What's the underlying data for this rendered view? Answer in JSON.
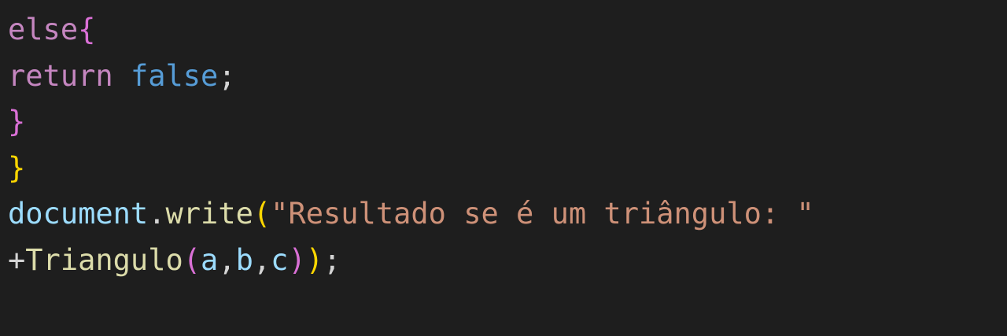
{
  "editor": {
    "background": "#1e1e1e",
    "lines": [
      [
        {
          "text": "else",
          "kind": "keyword"
        },
        {
          "text": "{",
          "kind": "bracket-pink"
        }
      ],
      [
        {
          "text": "return",
          "kind": "keyword"
        },
        {
          "text": " ",
          "kind": "plain"
        },
        {
          "text": "false",
          "kind": "bool"
        },
        {
          "text": ";",
          "kind": "plain"
        }
      ],
      [
        {
          "text": "}",
          "kind": "bracket-pink"
        }
      ],
      [
        {
          "text": "}",
          "kind": "bracket-gold"
        }
      ],
      [
        {
          "text": "document",
          "kind": "ident"
        },
        {
          "text": ".",
          "kind": "plain"
        },
        {
          "text": "write",
          "kind": "func"
        },
        {
          "text": "(",
          "kind": "bracket-gold"
        },
        {
          "text": "\"Resultado se é um triângulo: \"",
          "kind": "string"
        }
      ],
      [
        {
          "text": "+",
          "kind": "plain"
        },
        {
          "text": "Triangulo",
          "kind": "func"
        },
        {
          "text": "(",
          "kind": "bracket-pink"
        },
        {
          "text": "a",
          "kind": "ident"
        },
        {
          "text": ",",
          "kind": "plain"
        },
        {
          "text": "b",
          "kind": "ident"
        },
        {
          "text": ",",
          "kind": "plain"
        },
        {
          "text": "c",
          "kind": "ident"
        },
        {
          "text": ")",
          "kind": "bracket-pink"
        },
        {
          "text": ")",
          "kind": "bracket-gold"
        },
        {
          "text": ";",
          "kind": "plain"
        }
      ]
    ],
    "token_colors": {
      "keyword": "#c586c0",
      "bool": "#569cd6",
      "plain": "#d4d4d4",
      "ident": "#9cdcfe",
      "func": "#dcdcaa",
      "string": "#ce9178",
      "bracket-gold": "#ffd700",
      "bracket-pink": "#da70d6",
      "bracket-blue": "#179fff"
    }
  }
}
